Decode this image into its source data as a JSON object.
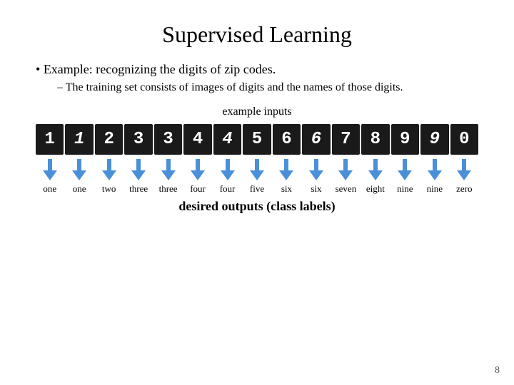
{
  "slide": {
    "title": "Supervised Learning",
    "bullet": "Example: recognizing the digits of zip codes.",
    "sub_bullet": "The training set consists of images of digits and the names of those digits.",
    "example_inputs_label": "example inputs",
    "desired_outputs_label": "desired outputs (class labels)",
    "digits": [
      "1",
      "1",
      "2",
      "3",
      "3",
      "4",
      "4",
      "5",
      "6",
      "6",
      "7",
      "8",
      "9",
      "9",
      "0"
    ],
    "labels": [
      "one",
      "one",
      "two",
      "three",
      "three",
      "four",
      "four",
      "five",
      "six",
      "six",
      "seven",
      "eight",
      "nine",
      "nine",
      "zero"
    ],
    "page_number": "8"
  }
}
